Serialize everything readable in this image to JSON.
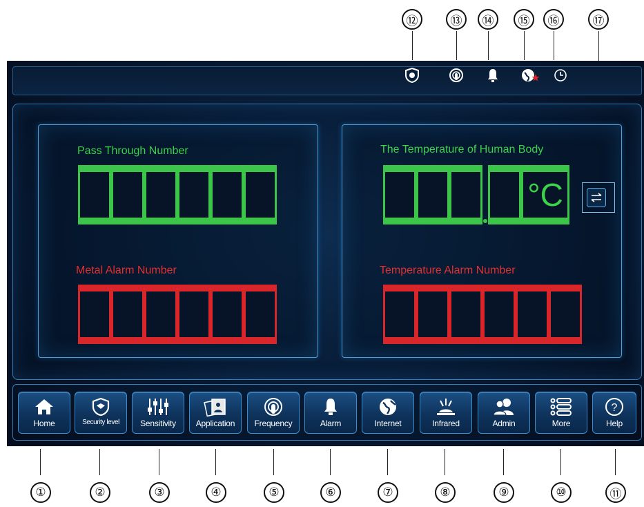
{
  "callouts": {
    "top": [
      "⑫",
      "⑬",
      "⑭",
      "⑮",
      "⑯",
      "⑰"
    ],
    "bottom": [
      "①",
      "②",
      "③",
      "④",
      "⑤",
      "⑥",
      "⑦",
      "⑧",
      "⑨",
      "⑩",
      "⑪"
    ]
  },
  "status_icons": [
    "shield-icon",
    "frequency-icon",
    "alarm-bell-icon",
    "internet-globe-icon",
    "clock-icon"
  ],
  "panels": {
    "pass_through": {
      "label": "Pass Through Number",
      "digits": 6
    },
    "metal_alarm": {
      "label": "Metal Alarm Number",
      "digits": 6
    },
    "body_temperature": {
      "label": "The Temperature of Human Body",
      "unit": "°C"
    },
    "temperature_alarm": {
      "label": "Temperature Alarm Number",
      "digits": 6
    }
  },
  "toolbar": {
    "buttons": [
      {
        "label": "Home",
        "icon": "home-icon"
      },
      {
        "label": "Security level",
        "icon": "shield-icon"
      },
      {
        "label": "Sensitivity",
        "icon": "sliders-icon"
      },
      {
        "label": "Application",
        "icon": "application-icon"
      },
      {
        "label": "Frequency",
        "icon": "frequency-icon"
      },
      {
        "label": "Alarm",
        "icon": "alarm-bell-icon"
      },
      {
        "label": "Internet",
        "icon": "globe-icon"
      },
      {
        "label": "Infrared",
        "icon": "infrared-icon"
      },
      {
        "label": "Admin",
        "icon": "users-icon"
      },
      {
        "label": "More",
        "icon": "list-icon"
      },
      {
        "label": "Help",
        "icon": "help-icon"
      }
    ]
  },
  "colors": {
    "background": "#071a33",
    "frame": "#3a7bb3",
    "green_display": "#3bc64a",
    "red_display": "#d8262a",
    "button": "#1b4f83"
  }
}
